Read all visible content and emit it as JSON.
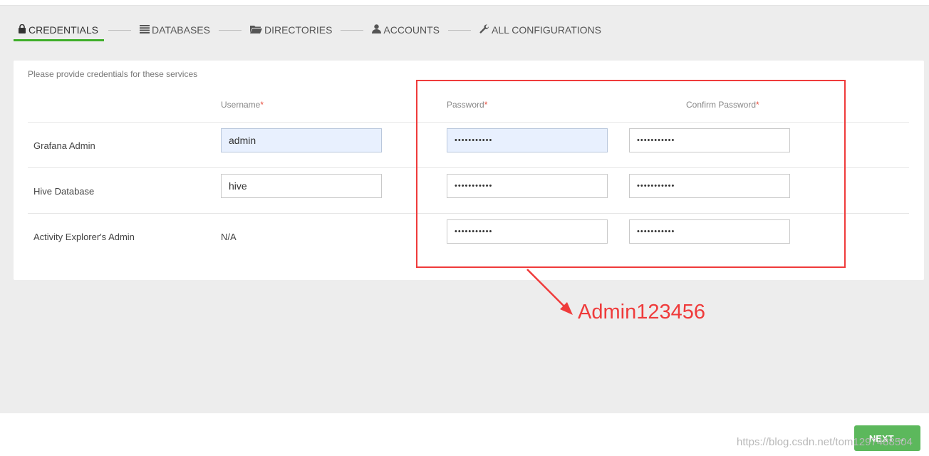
{
  "steps": [
    {
      "label": "CREDENTIALS",
      "icon": "lock-icon"
    },
    {
      "label": "DATABASES",
      "icon": "database-icon"
    },
    {
      "label": "DIRECTORIES",
      "icon": "folder-icon"
    },
    {
      "label": "ACCOUNTS",
      "icon": "user-icon"
    },
    {
      "label": "ALL CONFIGURATIONS",
      "icon": "wrench-icon"
    }
  ],
  "panel": {
    "description": "Please provide credentials for these services",
    "columns": {
      "username": "Username",
      "password": "Password",
      "confirm": "Confirm Password",
      "required_mark": "*"
    },
    "rows": [
      {
        "label": "Grafana Admin",
        "username": "admin",
        "password": "•••••••••••",
        "confirm": "•••••••••••"
      },
      {
        "label": "Hive Database",
        "username": "hive",
        "password": "•••••••••••",
        "confirm": "•••••••••••"
      },
      {
        "label": "Activity Explorer's Admin",
        "username": "N/A",
        "password": "•••••••••••",
        "confirm": "•••••••••••"
      }
    ]
  },
  "annotation": {
    "text": "Admin123456",
    "color": "#ef3b3b"
  },
  "footer": {
    "next_label": "NEXT →",
    "watermark": "https://blog.csdn.net/tom1297488504"
  },
  "colors": {
    "accent": "#3fae2a",
    "next_button": "#5cb85c"
  }
}
